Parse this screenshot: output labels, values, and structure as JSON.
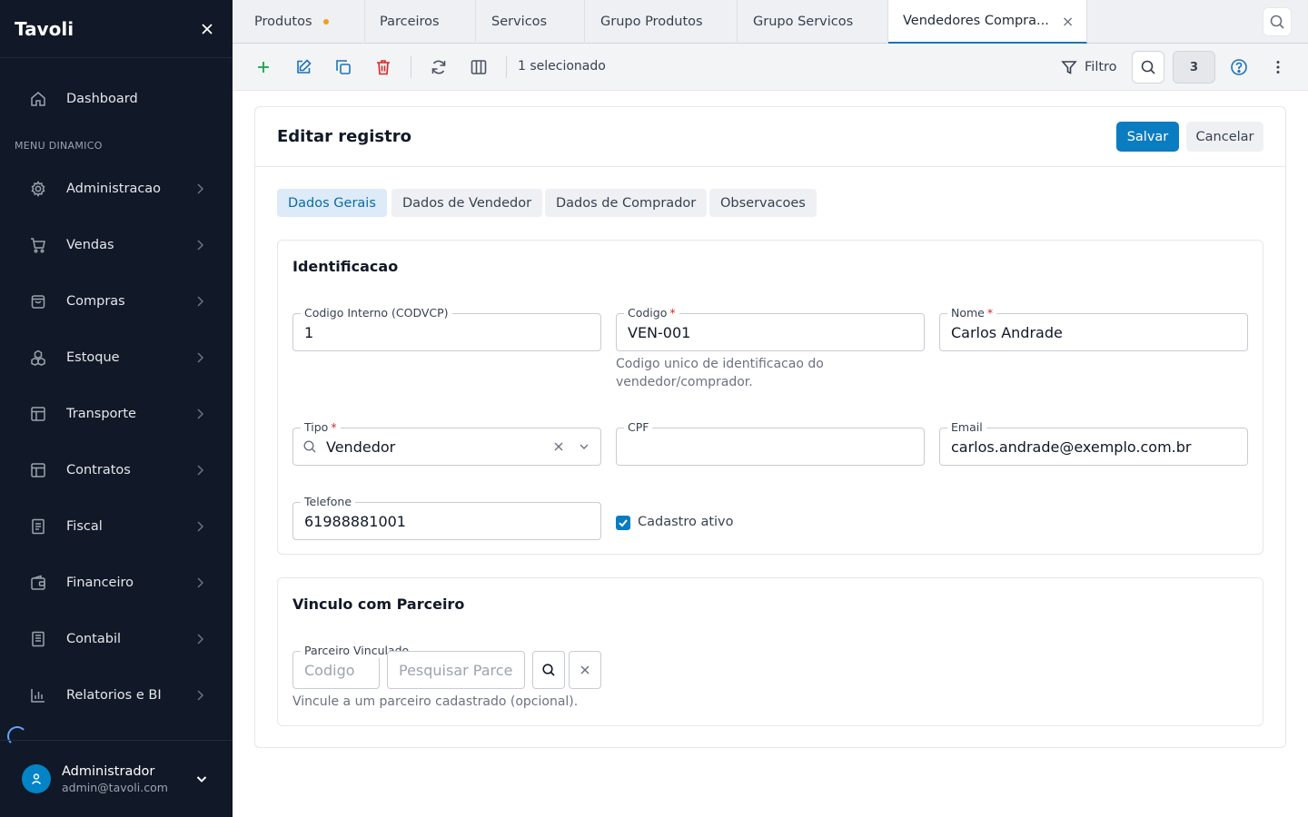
{
  "sidebar": {
    "brand": "Tavoli",
    "dashboard": "Dashboard",
    "section_label": "MENU DINAMICO",
    "items": [
      {
        "label": "Administracao",
        "icon": "gear-icon"
      },
      {
        "label": "Vendas",
        "icon": "cart-icon"
      },
      {
        "label": "Compras",
        "icon": "bag-icon"
      },
      {
        "label": "Estoque",
        "icon": "boxes-icon"
      },
      {
        "label": "Transporte",
        "icon": "layout-icon"
      },
      {
        "label": "Contratos",
        "icon": "layout-icon"
      },
      {
        "label": "Fiscal",
        "icon": "document-icon"
      },
      {
        "label": "Financeiro",
        "icon": "wallet-icon"
      },
      {
        "label": "Contabil",
        "icon": "book-icon"
      },
      {
        "label": "Relatorios e BI",
        "icon": "bar-chart-icon"
      }
    ],
    "user": {
      "name": "Administrador",
      "email": "admin@tavoli.com"
    }
  },
  "tabs": [
    {
      "label": "Produtos",
      "modified": true
    },
    {
      "label": "Parceiros"
    },
    {
      "label": "Servicos"
    },
    {
      "label": "Grupo Produtos"
    },
    {
      "label": "Grupo Servicos"
    },
    {
      "label": "Vendedores Compra...",
      "active": true
    }
  ],
  "toolbar": {
    "selection_text": "1 selecionado",
    "filter_label": "Filtro",
    "count": "3"
  },
  "form": {
    "title": "Editar registro",
    "save_label": "Salvar",
    "cancel_label": "Cancelar",
    "subtabs": [
      "Dados Gerais",
      "Dados de Vendedor",
      "Dados de Comprador",
      "Observacoes"
    ],
    "identificacao": {
      "title": "Identificacao",
      "codigo_interno": {
        "label": "Codigo Interno (CODVCP)",
        "value": "1"
      },
      "codigo": {
        "label": "Codigo",
        "value": "VEN-001",
        "hint_line1": "Codigo unico de identificacao do",
        "hint_line2": "vendedor/comprador."
      },
      "nome": {
        "label": "Nome",
        "value": "Carlos Andrade"
      },
      "tipo": {
        "label": "Tipo",
        "value": "Vendedor"
      },
      "cpf": {
        "label": "CPF",
        "value": ""
      },
      "email": {
        "label": "Email",
        "value": "carlos.andrade@exemplo.com.br"
      },
      "telefone": {
        "label": "Telefone",
        "value": "61988881001"
      },
      "ativo": {
        "label": "Cadastro ativo",
        "checked": true
      }
    },
    "vinculo": {
      "title": "Vinculo com Parceiro",
      "parceiro": {
        "label": "Parceiro Vinculado",
        "codigo_placeholder": "Codigo",
        "search_placeholder": "Pesquisar Parce"
      },
      "hint": "Vincule a um parceiro cadastrado (opcional)."
    }
  },
  "colors": {
    "sidebar_bg": "#111827",
    "primary": "#0a7cc1",
    "danger": "#dc2626",
    "add": "#16a34a",
    "modified_dot": "#f59e0b"
  }
}
